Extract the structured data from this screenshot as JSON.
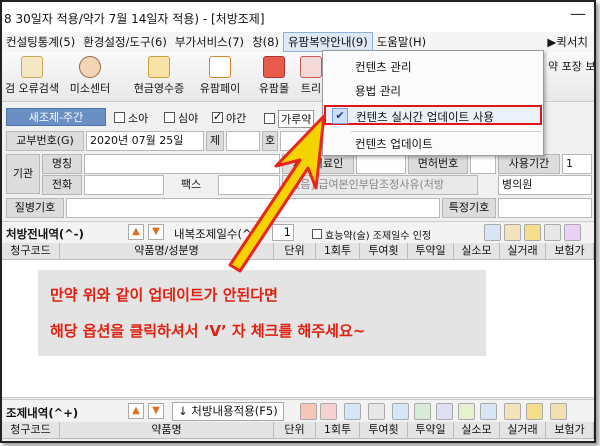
{
  "titlebar": {
    "text": "8 30일자 적용/약가 7월 14일자 적용) - [처방조제]"
  },
  "menu": {
    "items": [
      "컨설팅통계(5)",
      "환경설정/도구(6)",
      "부가서비스(7)",
      "창(8)",
      "유팜복약안내(9)",
      "도움말(H)"
    ],
    "right": "▶퀵서치"
  },
  "toolbar": {
    "buttons": [
      "검 오류검색",
      "미소센터",
      "현금영수증",
      "유팜페이",
      "유팜몰",
      "트리"
    ],
    "right_text": "약 포장 보"
  },
  "row1": {
    "new_label": "새조제-주간",
    "checks": [
      "소아",
      "심야",
      "야간",
      "가루약"
    ]
  },
  "form": {
    "issue_no_label": "교부번호(G)",
    "issue_date": "2020년 07월 25일",
    "je_label": "제",
    "ho_label": "호",
    "org_label": "기관",
    "name_label": "명칭",
    "phone_label": "전화",
    "fax_label": "팩스",
    "prescriber_label": "처방의료인",
    "license_label": "면허번호",
    "period_label": "사용기간",
    "period_value": "1",
    "exempt_placeholder": "[없음] 급여본인부담조정사유(처방",
    "hospital_type": "병의원",
    "disease_label": "질병기호",
    "special_label": "특정기호"
  },
  "prescription": {
    "title": "처방전내역(^-)",
    "days_label": "내복조제일수(^T)",
    "days_value": "1",
    "effect_label": "효능약(술) 조제일수 인정",
    "columns": [
      "청구코드",
      "약품명/성분명",
      "단위",
      "1회투",
      "투여횟",
      "투약일",
      "실소모",
      "실거래",
      "보험가"
    ]
  },
  "dispensing": {
    "title": "조제내역(^+)",
    "apply_btn": "처방내용적용(F5)",
    "columns": [
      "청구코드",
      "약품명",
      "단위",
      "1회투",
      "투여횟",
      "투약일",
      "실소모",
      "실거래",
      "보험가"
    ]
  },
  "dropdown": {
    "items": [
      "컨텐츠 관리",
      "용법 관리",
      "컨텐츠 실시간 업데이트 사용",
      "컨텐츠 업데이트"
    ],
    "checked_index": 2
  },
  "annotation": {
    "line1": "만약 위와 같이 업데이트가 안된다면",
    "line2": "해당 옵션을 클릭하셔서  ‘V’ 자 체크를 해주세요~"
  },
  "colors": {
    "accent_red": "#e01515",
    "arrow_red": "#e8261b",
    "arrow_yellow": "#f5d300"
  }
}
